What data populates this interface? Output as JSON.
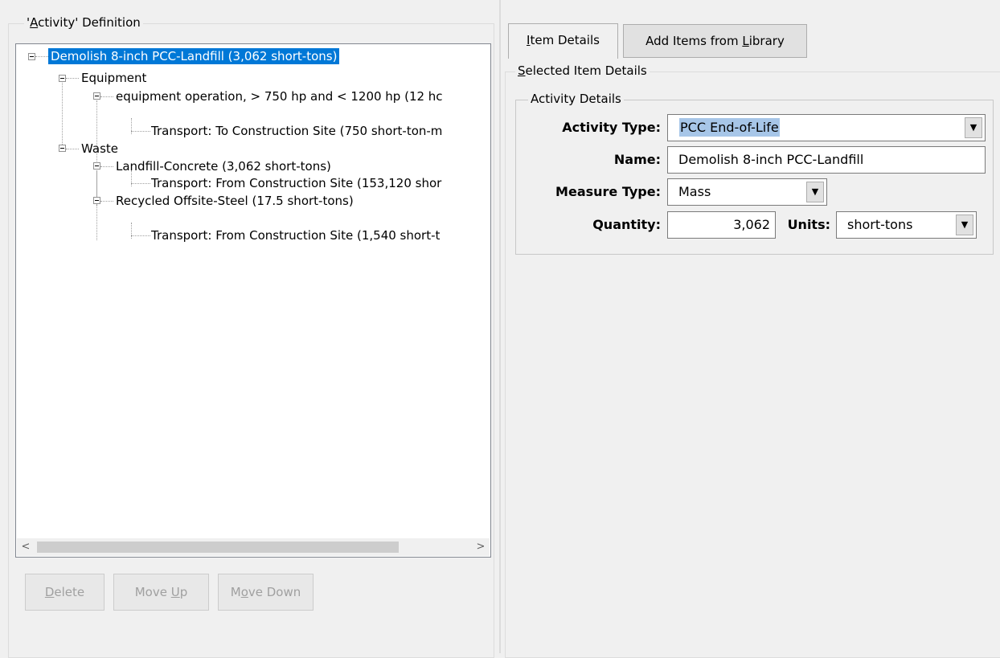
{
  "left_panel": {
    "legend_pre": "'",
    "legend_accel": "A",
    "legend_post": "ctivity' Definition"
  },
  "tree": {
    "nodes": [
      {
        "label": "Demolish 8-inch PCC-Landfill (3,062 short-tons)",
        "selected": true
      },
      {
        "label": "Equipment"
      },
      {
        "label": "equipment operation, > 750 hp and < 1200 hp (12 hc"
      },
      {
        "label": "Transport: To Construction Site (750 short-ton-m"
      },
      {
        "label": "Waste"
      },
      {
        "label": "Landfill-Concrete (3,062 short-tons)"
      },
      {
        "label": "Transport: From Construction Site (153,120 shor"
      },
      {
        "label": "Recycled Offsite-Steel (17.5 short-tons)"
      },
      {
        "label": "Transport: From Construction Site (1,540 short-t"
      }
    ],
    "scroll_left": "<",
    "scroll_right": ">"
  },
  "buttons": {
    "delete": {
      "accel": "D",
      "rest": "elete"
    },
    "move_up": {
      "pre": "Move ",
      "accel": "U",
      "post": "p"
    },
    "move_down": {
      "pre": "M",
      "accel": "o",
      "post": "ve Down"
    }
  },
  "tabs": {
    "item_details": {
      "accel": "I",
      "rest": "tem Details"
    },
    "add_items": {
      "pre": "Add Items from ",
      "accel": "L",
      "post": "ibrary"
    }
  },
  "selected_item": {
    "legend_accel": "S",
    "legend_rest": "elected Item Details"
  },
  "activity_details": {
    "legend": "Activity Details",
    "activity_type_label": "Activity Type:",
    "activity_type_value": "PCC End-of-Life",
    "name_label": "Name:",
    "name_value": "Demolish 8-inch PCC-Landfill",
    "measure_type_label": "Measure Type:",
    "measure_type_value": "Mass",
    "quantity_label": "Quantity:",
    "quantity_value": "3,062",
    "units_label": "Units:",
    "units_value": "short-tons"
  },
  "icons": {
    "dropdown_arrow": "▼"
  }
}
